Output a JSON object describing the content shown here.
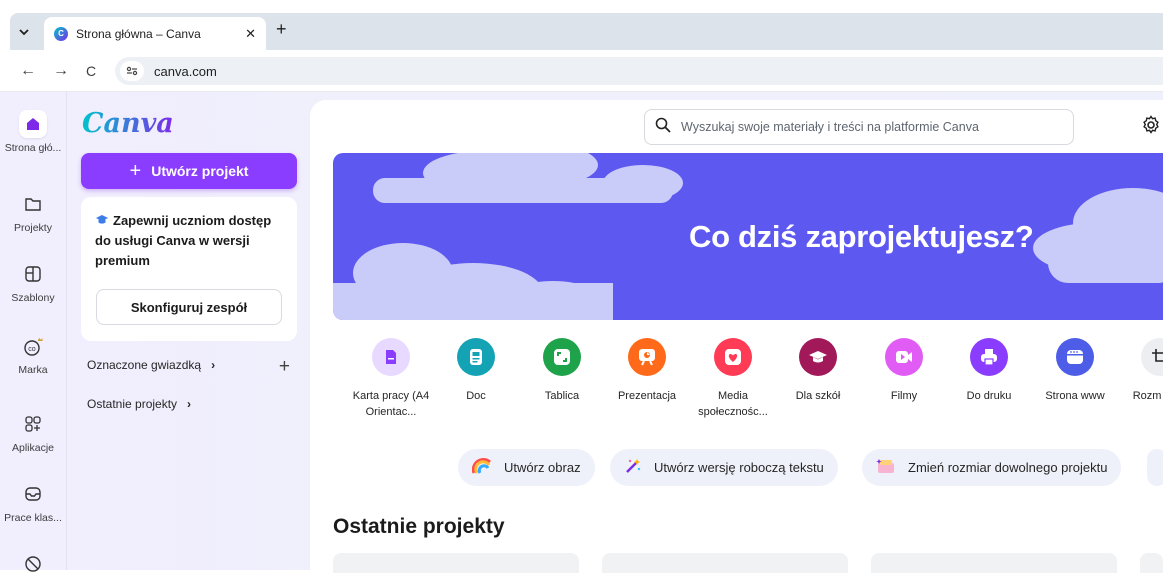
{
  "browser": {
    "tab_title": "Strona główna – Canva",
    "tab_close": "✕",
    "new_tab": "+",
    "tab_menu": "⌄",
    "url": "canva.com",
    "back": "←",
    "forward": "→",
    "reload": "C",
    "site_info": "⚙"
  },
  "rail": {
    "items": [
      {
        "label": "Strona głó...",
        "icon": "home-icon"
      },
      {
        "label": "Projekty",
        "icon": "folder-icon"
      },
      {
        "label": "Szablony",
        "icon": "template-icon"
      },
      {
        "label": "Marka",
        "icon": "brand-icon"
      },
      {
        "label": "Aplikacje",
        "icon": "apps-icon"
      },
      {
        "label": "Prace klas...",
        "icon": "inbox-icon"
      }
    ]
  },
  "sidepanel": {
    "logo": "Canva",
    "create_label": "Utwórz projekt",
    "create_plus": "+",
    "promo_text": "Zapewnij uczniom dostęp do usługi Canva w wersji premium",
    "promo_button": "Skonfiguruj zespół",
    "starred": "Oznaczone gwiazdką",
    "recent": "Ostatnie projekty",
    "plus": "+",
    "chevron": "›"
  },
  "main": {
    "search_placeholder": "Wyszukaj swoje materiały i treści na platformie Canva",
    "hero_title": "Co dziś zaprojektujesz?",
    "categories": [
      {
        "label": "Karta pracy (A4 Orientac...",
        "color": "#e7d9ff",
        "icon": "worksheet-icon"
      },
      {
        "label": "Doc",
        "color": "#13a3b5",
        "icon": "doc-icon"
      },
      {
        "label": "Tablica",
        "color": "#1fa34a",
        "icon": "whiteboard-icon"
      },
      {
        "label": "Prezentacja",
        "color": "#ff6a1a",
        "icon": "presentation-icon"
      },
      {
        "label": "Media społecznośc...",
        "color": "#ff3b55",
        "icon": "social-icon"
      },
      {
        "label": "Dla szkół",
        "color": "#a2195a",
        "icon": "school-icon"
      },
      {
        "label": "Filmy",
        "color": "#e05cf5",
        "icon": "video-icon"
      },
      {
        "label": "Do druku",
        "color": "#8b3dff",
        "icon": "print-icon"
      },
      {
        "label": "Strona www",
        "color": "#4e5de8",
        "icon": "website-icon"
      },
      {
        "label": "Rozm niestan",
        "color": "#eceef1",
        "icon": "resize-icon"
      }
    ],
    "pills": [
      {
        "label": "Utwórz obraz",
        "icon": "rainbow-icon"
      },
      {
        "label": "Utwórz wersję roboczą tekstu",
        "icon": "magic-write-icon"
      },
      {
        "label": "Zmień rozmiar dowolnego projektu",
        "icon": "magic-resize-icon"
      }
    ],
    "recent_title": "Ostatnie projekty"
  }
}
